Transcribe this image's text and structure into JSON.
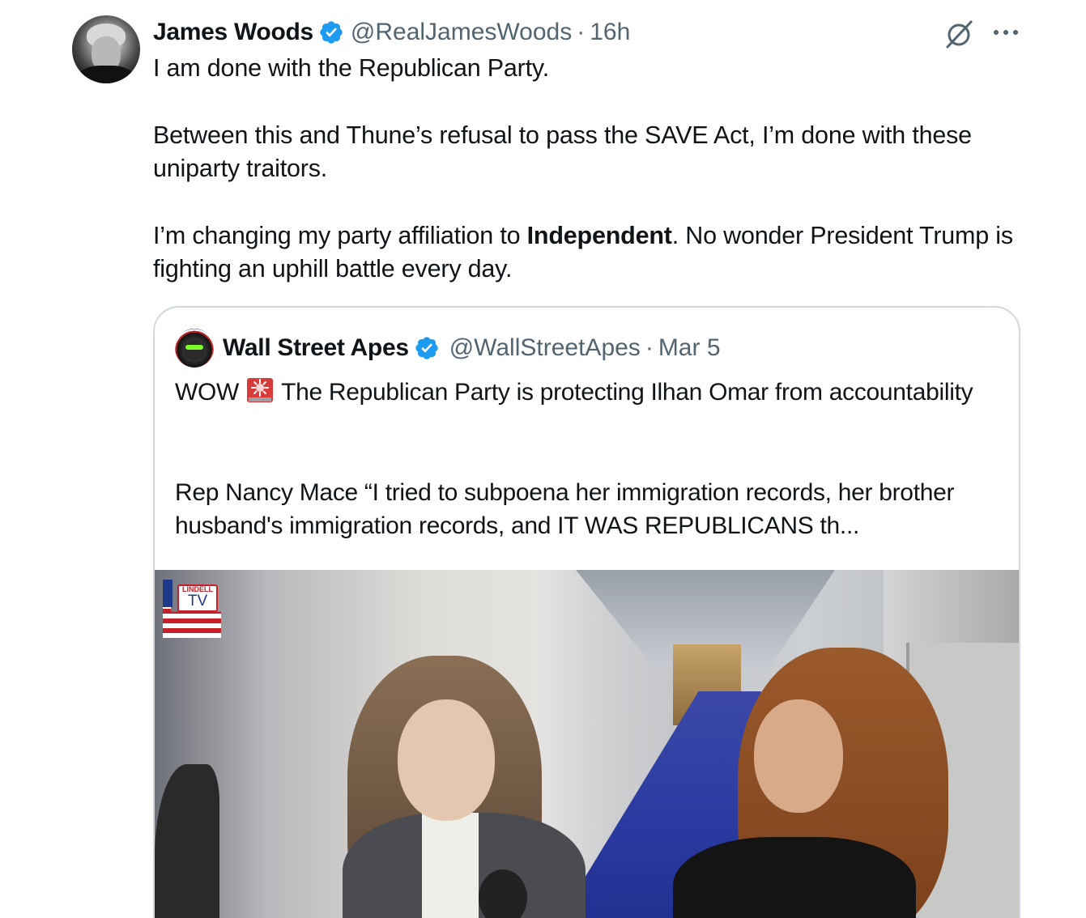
{
  "tweet": {
    "author_name": "James Woods",
    "handle": "@RealJamesWoods",
    "separator": "·",
    "time": "16h",
    "text_line1": "I am done with the Republican Party.",
    "text_para2": "Between this and Thune’s refusal to pass the SAVE Act, I’m done with these uniparty traitors.",
    "text_para3_before": "I’m changing my party affiliation to ",
    "text_para3_bold": "Independent",
    "text_para3_after": ". No wonder President Trump is fighting an uphill battle every day."
  },
  "quoted": {
    "author_name": "Wall Street Apes",
    "handle": "@WallStreetApes",
    "separator": "·",
    "date": "Mar 5",
    "text1_before": "WOW",
    "text1_after": "The Republican Party is protecting Ilhan Omar from accountability",
    "text2": "Rep Nancy Mace “I tried to subpoena her immigration records, her brother husband's immigration records, and IT WAS REPUBLICANS th...",
    "video_watermark_top": "LINDELL",
    "video_watermark_bottom": "TV"
  },
  "icons": {
    "verified": "verified-badge-icon",
    "grok": "grok-icon",
    "more": "more-options-icon",
    "siren": "rotating-light-emoji-icon"
  },
  "colors": {
    "verified_blue": "#1d9bf0",
    "secondary_text": "#536471",
    "border": "#cfd9de"
  }
}
